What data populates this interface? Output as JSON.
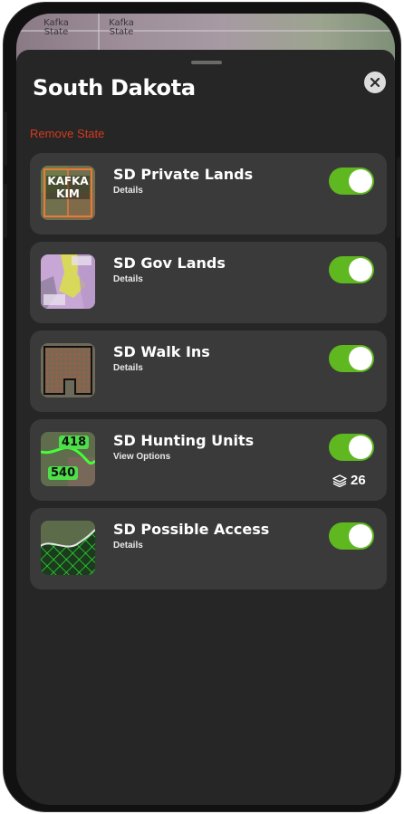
{
  "map": {
    "label_left": "Kafka\nState",
    "label_mid": "Kafka\nState"
  },
  "sheet": {
    "title": "South Dakota",
    "remove_label": "Remove State"
  },
  "layers": [
    {
      "name": "SD Private Lands",
      "sub": "Details",
      "enabled": true,
      "thumb_text_1": "KAFKA",
      "thumb_text_2": "KIM"
    },
    {
      "name": "SD Gov Lands",
      "sub": "Details",
      "enabled": true
    },
    {
      "name": "SD Walk Ins",
      "sub": "Details",
      "enabled": true
    },
    {
      "name": "SD Hunting Units",
      "sub": "View Options",
      "enabled": true,
      "count": "26",
      "unit_1": "418",
      "unit_2": "540"
    },
    {
      "name": "SD Possible Access",
      "sub": "Details",
      "enabled": true
    }
  ],
  "colors": {
    "toggle_on": "#5fb820",
    "remove": "#d43a1f",
    "card": "#3a3a3a",
    "sheet": "#262626"
  },
  "icons": [
    "close-icon",
    "layers-icon"
  ]
}
